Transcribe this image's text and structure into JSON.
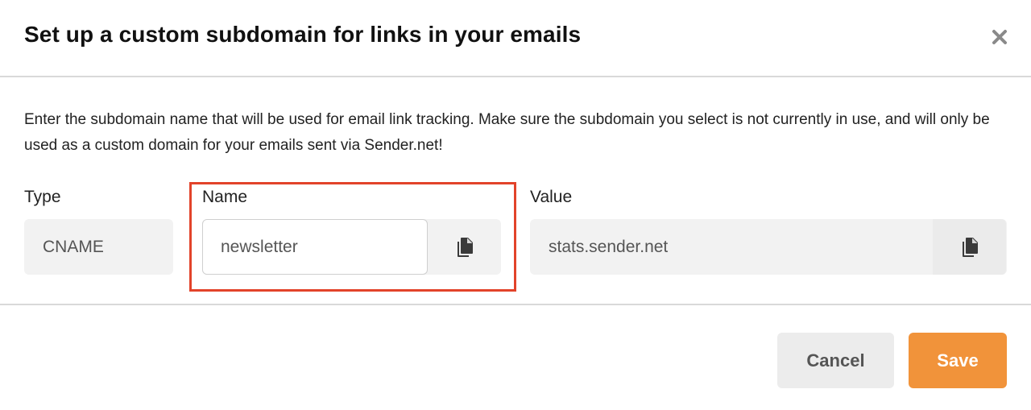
{
  "dialog": {
    "title": "Set up a custom subdomain for links in your emails",
    "description": "Enter the subdomain name that will be used for email link tracking. Make sure the subdomain you select is not currently in use, and will only be used as a custom domain for your emails sent via Sender.net!"
  },
  "record": {
    "type_label": "Type",
    "type_value": "CNAME",
    "name_label": "Name",
    "name_value": "newsletter",
    "value_label": "Value",
    "value_value": "stats.sender.net"
  },
  "footer": {
    "cancel_label": "Cancel",
    "save_label": "Save"
  },
  "icons": {
    "close": "close-icon",
    "copy": "copy-icon"
  },
  "colors": {
    "accent": "#f1933a",
    "highlight": "#e2432a"
  }
}
